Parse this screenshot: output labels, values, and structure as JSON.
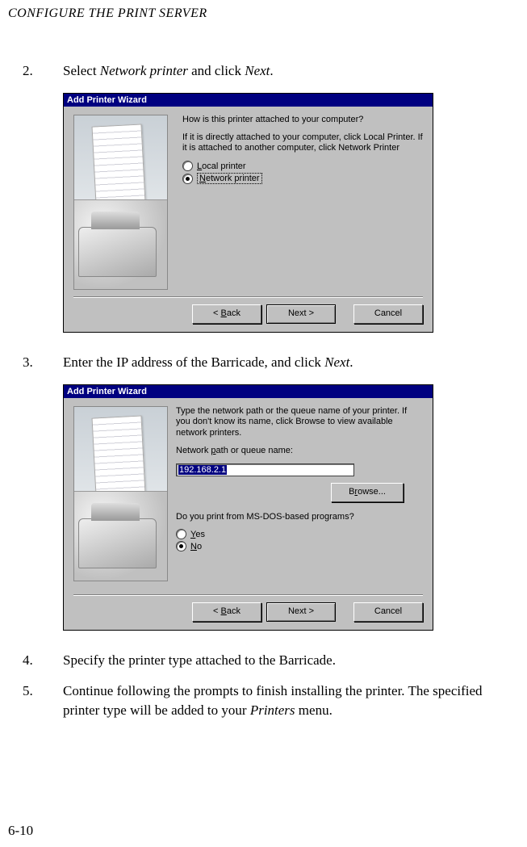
{
  "header": "CONFIGURE THE PRINT SERVER",
  "page_number": "6-10",
  "steps": {
    "s2": {
      "num": "2.",
      "pre": "Select ",
      "em1": "Network printer",
      "mid": " and click ",
      "em2": "Next",
      "post": "."
    },
    "s3": {
      "num": "3.",
      "pre": "Enter the IP address of the Barricade, and click ",
      "em1": "Next",
      "post": "."
    },
    "s4": {
      "num": "4.",
      "text": "Specify the printer type attached to the Barricade."
    },
    "s5": {
      "num": "5.",
      "pre": "Continue following the prompts to finish installing the printer. The specified printer type will be added to your ",
      "em1": "Printers",
      "post": " menu."
    }
  },
  "wizard1": {
    "title": "Add Printer Wizard",
    "q": "How is this printer attached to your computer?",
    "info": "If it is directly attached to your computer, click Local Printer. If it is attached to another computer, click Network Printer",
    "opt_local_pre": "L",
    "opt_local_rest": "ocal printer",
    "opt_net_pre": "N",
    "opt_net_rest": "etwork printer",
    "back_lt": "<",
    "back_u": "B",
    "back_rest": "ack",
    "next": "Next >",
    "cancel": "Cancel"
  },
  "wizard2": {
    "title": "Add Printer Wizard",
    "info": "Type the network path or the queue name of your printer. If you don't know its name, click Browse to view available network printers.",
    "path_label_pre": "Network ",
    "path_label_u": "p",
    "path_label_rest": "ath or queue name:",
    "path_value": "192.168.2.1",
    "browse_pre": "B",
    "browse_u": "r",
    "browse_rest": "owse...",
    "dos_q": "Do you print from MS-DOS-based programs?",
    "yes_u": "Y",
    "yes_rest": "es",
    "no_u": "N",
    "no_rest": "o",
    "back_lt": "<",
    "back_u": "B",
    "back_rest": "ack",
    "next": "Next >",
    "cancel": "Cancel"
  }
}
